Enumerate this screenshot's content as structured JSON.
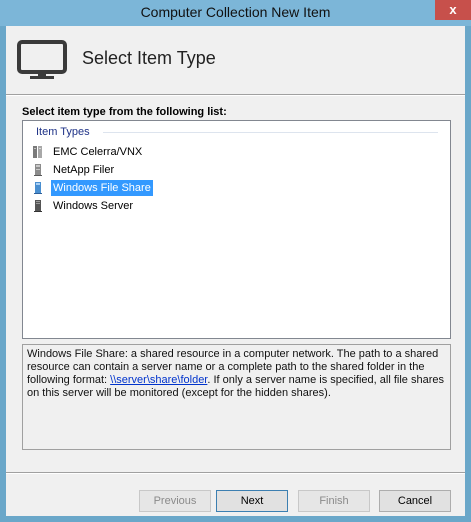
{
  "window": {
    "title": "Computer Collection New Item",
    "close_glyph": "x"
  },
  "header": {
    "icon": "monitor-icon",
    "title": "Select Item Type"
  },
  "list": {
    "heading": "Select item type from the following list:",
    "group_header": "Item Types",
    "items": [
      {
        "label": "EMC Celerra/VNX",
        "icon": "storage-array-icon",
        "selected": false
      },
      {
        "label": "NetApp Filer",
        "icon": "filer-icon",
        "selected": false
      },
      {
        "label": "Windows File Share",
        "icon": "file-share-icon",
        "selected": true
      },
      {
        "label": "Windows Server",
        "icon": "server-icon",
        "selected": false
      }
    ]
  },
  "description": {
    "before_link": "Windows File Share: a shared resource in a computer network. The path to a shared resource can contain a server name or a complete path to the shared folder in the following format: ",
    "link": "\\\\server\\share\\folder",
    "after_link": ". If only a server name is specified, all file shares on this server will be monitored (except for the hidden shares)."
  },
  "buttons": {
    "previous": "Previous",
    "next": "Next",
    "finish": "Finish",
    "cancel": "Cancel"
  },
  "colors": {
    "selection": "#3399ff",
    "titlebar": "#7cb6d8",
    "close": "#c7504b"
  }
}
